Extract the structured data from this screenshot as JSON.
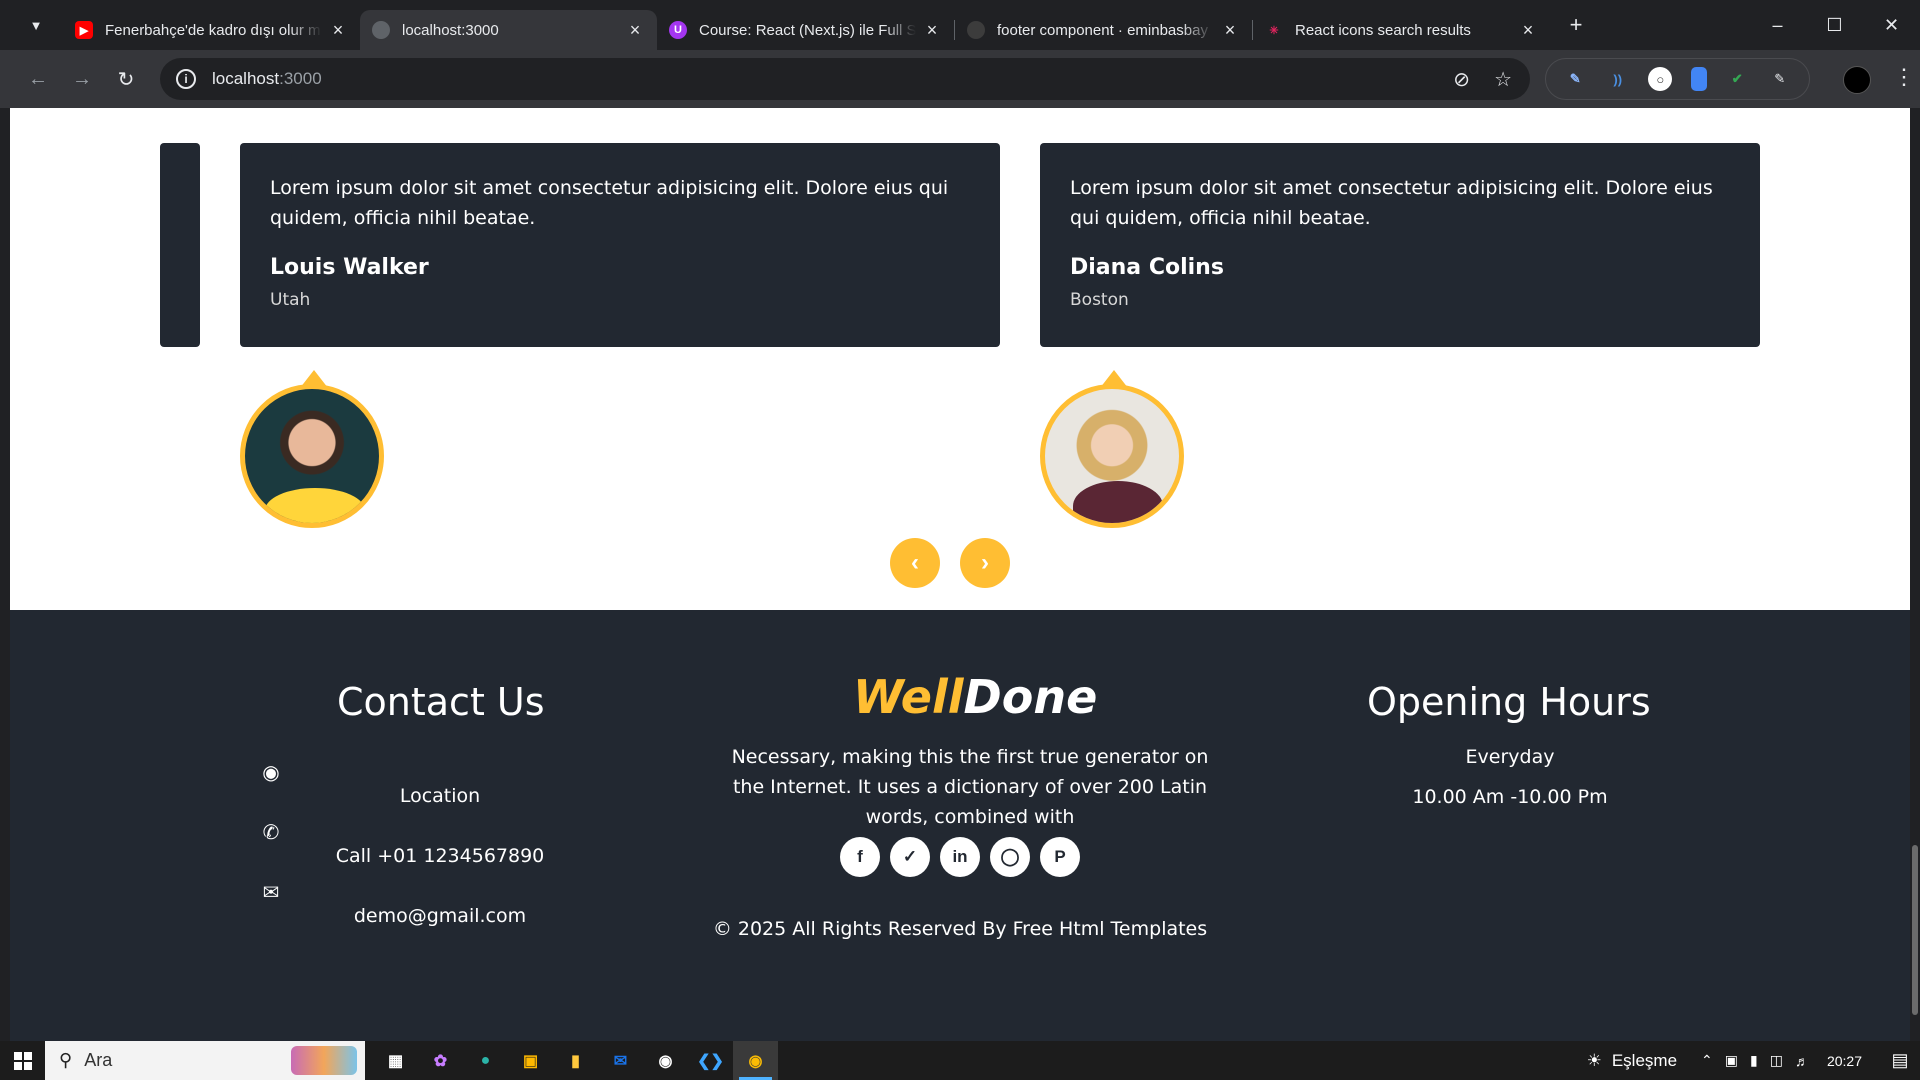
{
  "browser": {
    "tabs": [
      {
        "title": "Fenerbahçe'de kadro dışı olur m",
        "favicon": "youtube-icon",
        "active": false
      },
      {
        "title": "localhost:3000",
        "favicon": "globe-icon",
        "active": true
      },
      {
        "title": "Course: React (Next.js) ile Full St",
        "favicon": "udemy-icon",
        "active": false
      },
      {
        "title": "footer component · eminbasbay",
        "favicon": "github-icon",
        "active": false
      },
      {
        "title": "React icons search results",
        "favicon": "react-icon",
        "active": false
      }
    ],
    "url_host": "localhost",
    "url_rest": ":3000"
  },
  "colors": {
    "accent": "#ffbe33",
    "dark": "#222831",
    "white": "#ffffff"
  },
  "testimonials": [
    {
      "quote": "Lorem ipsum dolor sit amet consectetur adipisicing elit. Dolore eius qui quidem, officia nihil beatae.",
      "name": "Louis Walker",
      "city": "Utah"
    },
    {
      "quote": "Lorem ipsum dolor sit amet consectetur adipisicing elit. Dolore eius qui quidem, officia nihil beatae.",
      "name": "Diana Colins",
      "city": "Boston"
    }
  ],
  "slider": {
    "prev_icon": "‹",
    "next_icon": "›"
  },
  "footer": {
    "contact_title": "Contact Us",
    "location": "Location",
    "phone": "Call +01 1234567890",
    "email": "demo@gmail.com",
    "brand_part1": "Well",
    "brand_part2": "Done",
    "about": "Necessary, making this the first true generator on the Internet. It uses a dictionary of over 200 Latin words, combined with",
    "socials": [
      "facebook-icon",
      "twitter-icon",
      "linkedin-icon",
      "instagram-icon",
      "pinterest-icon"
    ],
    "hours_title": "Opening Hours",
    "hours_days": "Everyday",
    "hours_time": "10.00 Am -10.00 Pm",
    "copyright": "© 2025 All Rights Reserved By Free Html Templates"
  },
  "taskbar": {
    "search_placeholder": "Ara",
    "weather_label": "Eşleşme",
    "time": "20:27"
  }
}
